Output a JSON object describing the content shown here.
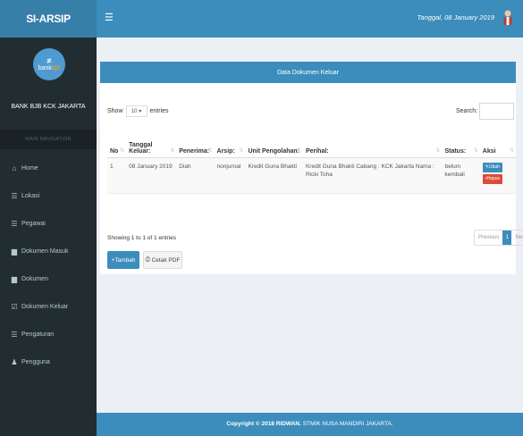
{
  "header": {
    "app_title": "SI-ARSIP",
    "menu_toggle_icon": "menu-icon",
    "date_text": "Tanggal, 08 January 2019"
  },
  "sidebar": {
    "logo_mark": "≠",
    "logo_word_a": "bank",
    "logo_word_b": "bjb",
    "branch_name": "BANK BJB KCK JAKARTA",
    "nav_header": "MAIN NAVIGATION",
    "items": [
      {
        "label": "Home",
        "icon": "home-icon",
        "glyph": "⌂"
      },
      {
        "label": "Lokasi",
        "icon": "list-icon",
        "glyph": "☰"
      },
      {
        "label": "Pegawai",
        "icon": "list-icon",
        "glyph": "☰"
      },
      {
        "label": "Dokumen Masuk",
        "icon": "folder-icon",
        "glyph": "▆"
      },
      {
        "label": "Dokumen",
        "icon": "folder-icon",
        "glyph": "▆"
      },
      {
        "label": "Dokumen Keluar",
        "icon": "checkbox-icon",
        "glyph": "☑"
      },
      {
        "label": "Pengaturan",
        "icon": "list-icon",
        "glyph": "☰"
      },
      {
        "label": "Pengguna",
        "icon": "user-icon",
        "glyph": "♟"
      }
    ]
  },
  "main": {
    "box_title": "Data Dokumen Keluar",
    "show_label": "Show",
    "entries_value": "10",
    "entries_label": "entries",
    "search_label": "Search:",
    "search_value": "",
    "table": {
      "columns": [
        "No",
        "Tanggal Keluar:",
        "Penerima:",
        "Arsip:",
        "Unit Pengolahan:",
        "Perihal:",
        "Status:",
        "Aksi"
      ],
      "rows": [
        {
          "no": "1",
          "tanggal": "08 January 2019",
          "penerima": "Diah",
          "arsip": "nonjurnal",
          "unit": "Kredit Guna Bhakti",
          "perihal": "Kredit Guna Bhakti Cabang : KCK Jakarta Nama : Ricki Toha",
          "status": "belum kembali",
          "ubah_label": "Ubah",
          "hapus_label": "Hapus"
        }
      ]
    },
    "showing_text": "Showing 1 to 1 of 1 entries",
    "pagination": {
      "previous": "Previous",
      "current": "1",
      "next": "Next"
    },
    "tambah_label": "Tambah",
    "cetak_label": "Cetak PDF"
  },
  "footer": {
    "prefix": "Copyright © 2018 ",
    "author": "RIDWAN.",
    "suffix": " STMIK NUSA MANDIRI JAKARTA."
  },
  "colors": {
    "primary": "#3c8dbc",
    "sidebar": "#222d32",
    "danger": "#dd4b39"
  }
}
